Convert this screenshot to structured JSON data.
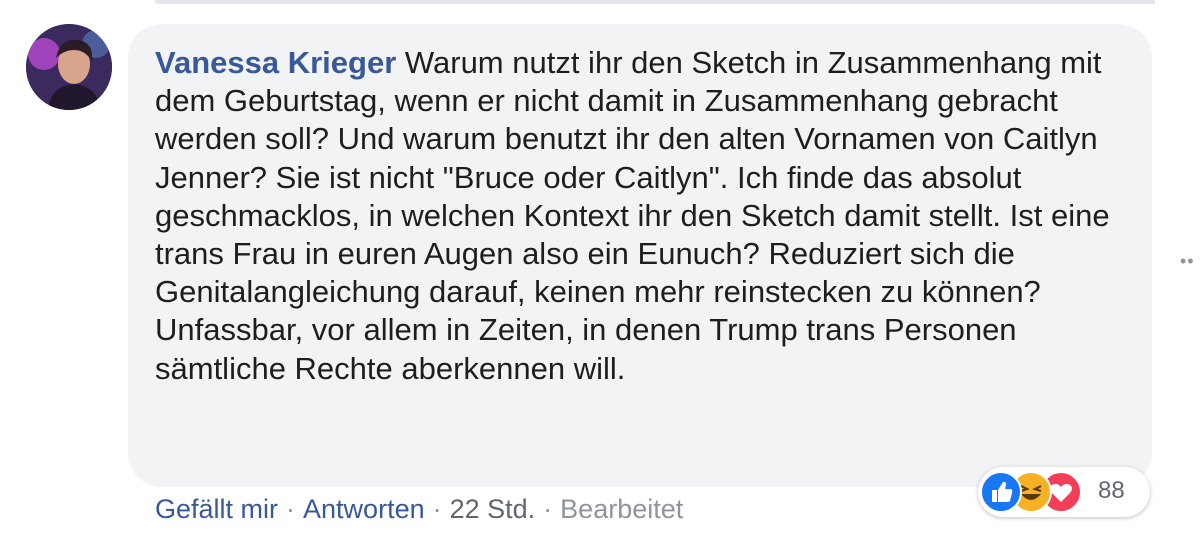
{
  "comment": {
    "author": "Vanessa Krieger",
    "text": "Warum nutzt ihr den Sketch in Zusammenhang mit dem Geburtstag, wenn er nicht damit in Zusammenhang gebracht werden soll? Und warum benutzt ihr den alten Vornamen von Caitlyn Jenner? Sie ist nicht \"Bruce oder Caitlyn\". Ich finde das absolut geschmacklos, in welchen Kontext ihr den Sketch damit stellt. Ist eine trans Frau in euren Augen also ein Eunuch? Reduziert sich die Genitalangleichung darauf, keinen mehr reinstecken zu können? Unfassbar, vor allem in Zeiten, in denen Trump trans Personen sämtliche Rechte aberkennen will."
  },
  "actions": {
    "like": "Gefällt mir",
    "reply": "Antworten",
    "time": "22 Std.",
    "edited": "Bearbeitet",
    "separator": "·"
  },
  "reactions": {
    "types": [
      "like-icon",
      "haha-icon",
      "love-icon"
    ],
    "count": "88"
  },
  "more_options": "••",
  "colors": {
    "author_link": "#385898",
    "bubble": "#f2f3f5",
    "meta": "#90949c",
    "like": "#1877f2",
    "haha": "#f7b125",
    "love": "#f33e58"
  }
}
